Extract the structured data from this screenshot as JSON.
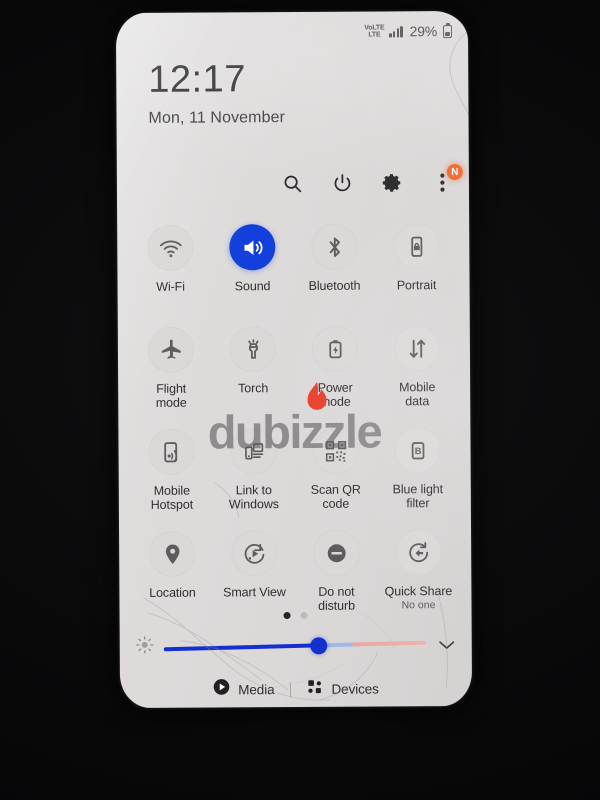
{
  "device": {
    "status_bar": {
      "volte_line1": "VoLTE",
      "volte_label_top": "VoLTE",
      "volte_top": "VoLTE",
      "network_top": "VoLTE",
      "network_line_a": "VoLTE",
      "network_line_b": "LTE",
      "network_primary": "VoLTE",
      "volte_upper": "VoLTE",
      "volte_lower": "LTE",
      "battery_percent": "29%",
      "signal_icon": "signal-bars-icon",
      "battery_icon": "battery-icon"
    },
    "lock_panel": {
      "time": "12:17",
      "date": "Mon, 11 November"
    }
  },
  "header_actions": [
    {
      "name": "search-icon",
      "label": "Search"
    },
    {
      "name": "power-icon",
      "label": "Power off"
    },
    {
      "name": "gear-icon",
      "label": "Settings"
    },
    {
      "name": "more-options-icon",
      "label": "More options",
      "badge": "N"
    }
  ],
  "quick_settings": {
    "tiles": [
      {
        "label": "Wi-Fi",
        "icon": "wifi-icon",
        "active": false,
        "sub": ""
      },
      {
        "label": "Sound",
        "icon": "sound-icon",
        "active": true,
        "sub": ""
      },
      {
        "label": "Bluetooth",
        "icon": "bluetooth-icon",
        "active": false,
        "sub": ""
      },
      {
        "label": "Portrait",
        "icon": "screen-rotation-icon",
        "active": false,
        "sub": ""
      },
      {
        "label": "Flight\nmode",
        "icon": "airplane-icon",
        "active": false,
        "sub": ""
      },
      {
        "label": "Torch",
        "icon": "flashlight-icon",
        "active": false,
        "sub": ""
      },
      {
        "label": "Power\nmode",
        "icon": "battery-power-icon",
        "active": false,
        "sub": ""
      },
      {
        "label": "Mobile\ndata",
        "icon": "mobile-data-icon",
        "active": false,
        "sub": ""
      },
      {
        "label": "Mobile\nHotspot",
        "icon": "hotspot-icon",
        "active": false,
        "sub": ""
      },
      {
        "label": "Link to\nWindows",
        "icon": "link-windows-icon",
        "active": false,
        "sub": ""
      },
      {
        "label": "Scan QR\ncode",
        "icon": "qr-code-icon",
        "active": false,
        "sub": ""
      },
      {
        "label": "Blue light\nfilter",
        "icon": "blue-light-icon",
        "active": false,
        "sub": ""
      },
      {
        "label": "Location",
        "icon": "location-pin-icon",
        "active": false,
        "sub": ""
      },
      {
        "label": "Smart View",
        "icon": "smart-view-icon",
        "active": false,
        "sub": ""
      },
      {
        "label": "Do not\ndisturb",
        "icon": "do-not-disturb-icon",
        "active": false,
        "sub": ""
      },
      {
        "label": "Quick Share",
        "icon": "quick-share-icon",
        "active": false,
        "sub": "No one"
      }
    ],
    "page_dots": {
      "count": 2,
      "active_index": 0
    }
  },
  "brightness": {
    "icon": "brightness-icon",
    "value_percent": 59,
    "expand_icon": "chevron-down-icon"
  },
  "bottom_bar": {
    "media_label": "Media",
    "media_icon": "play-circle-icon",
    "devices_label": "Devices",
    "devices_icon": "devices-grid-icon"
  },
  "watermark": {
    "text": "dubizzle"
  },
  "colors": {
    "accent_blue": "#1340dd",
    "panel_bg": "#dedbdb",
    "tile_bg": "#dcd8d8",
    "badge_orange": "#f0622a",
    "text_primary": "#2f2f32"
  }
}
